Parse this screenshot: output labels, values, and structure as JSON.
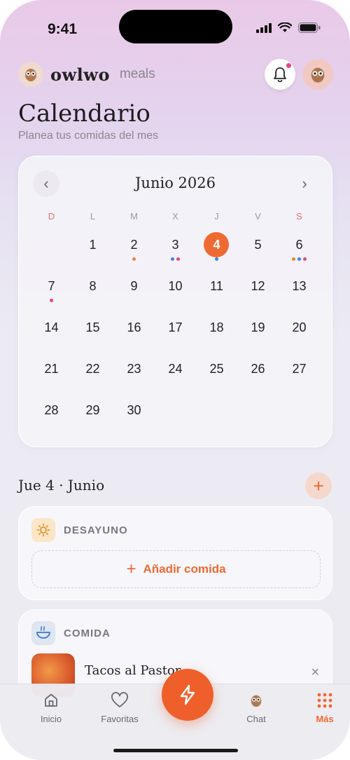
{
  "status": {
    "time": "9:41"
  },
  "header": {
    "brand": "owlwo",
    "section": "meals"
  },
  "page": {
    "title": "Calendario",
    "subtitle": "Planea tus comidas del mes"
  },
  "calendar": {
    "month": "Junio 2026",
    "weekdays": [
      "D",
      "L",
      "M",
      "X",
      "J",
      "V",
      "S"
    ],
    "weeks": [
      [
        null,
        1,
        2,
        3,
        4,
        5,
        6
      ],
      [
        7,
        8,
        9,
        10,
        11,
        12,
        13
      ],
      [
        14,
        15,
        16,
        17,
        18,
        19,
        20
      ],
      [
        21,
        22,
        23,
        24,
        25,
        26,
        27
      ],
      [
        28,
        29,
        30,
        null,
        null,
        null,
        null
      ]
    ],
    "today": 4,
    "dots": {
      "2": [
        "#f0862e"
      ],
      "3": [
        "#3b82f6",
        "#e8477a"
      ],
      "4": [
        "#3b82f6"
      ],
      "6": [
        "#f0862e",
        "#3b82f6",
        "#e8477a"
      ],
      "7": [
        "#e8477a"
      ]
    }
  },
  "selected_day": {
    "label": "Jue 4 · Junio"
  },
  "meals": {
    "breakfast": {
      "label": "DESAYUNO",
      "add_label": "Añadir comida"
    },
    "lunch": {
      "label": "COMIDA",
      "recipe_name": "Tacos al Pastor"
    }
  },
  "tabs": {
    "home": "Inicio",
    "favorites": "Favoritas",
    "chat": "Chat",
    "more": "Más"
  },
  "colors": {
    "accent": "#ef6a32",
    "sunday_saturday": "#e07272"
  }
}
